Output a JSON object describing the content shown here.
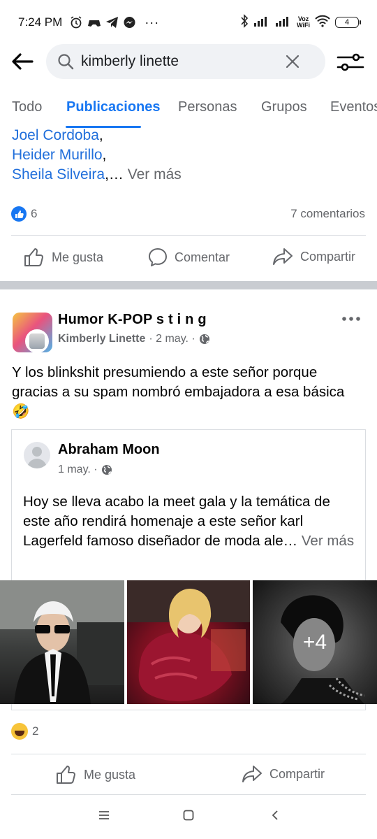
{
  "status_bar": {
    "time": "7:24 PM",
    "network_label": "Voz\nWiFi",
    "battery": "4"
  },
  "search": {
    "query": "kimberly linette"
  },
  "tabs": [
    {
      "label": "Todo",
      "active": false
    },
    {
      "label": "Publicaciones",
      "active": true
    },
    {
      "label": "Personas",
      "active": false
    },
    {
      "label": "Grupos",
      "active": false
    },
    {
      "label": "Eventos",
      "active": false
    }
  ],
  "previous_post": {
    "names": [
      "Joel Cordoba",
      "Heider Murillo",
      "Sheila Silveira"
    ],
    "comma": ",",
    "ellipsis": ",…",
    "see_more": "Ver más",
    "likes_count": "6",
    "comments_count": "7 comentarios",
    "actions": {
      "like": "Me gusta",
      "comment": "Comentar",
      "share": "Compartir"
    }
  },
  "post": {
    "page_name": "Humor K-POP s t i n g",
    "author": "Kimberly Linette",
    "date": "· 2 may. ·",
    "text": "Y los blinkshit presumiendo a este señor porque gracias a su spam nombró embajadora a esa básica 🤣",
    "shared": {
      "name": "Abraham Moon",
      "date": "1 may. ·",
      "text": "Hoy se lleva acabo la meet gala y la temática de este año rendirá homenaje a este señor karl Lagerfeld famoso diseñador de moda ale…",
      "see_more": "Ver más",
      "photos_more": "+4"
    },
    "reactions_count": "2",
    "actions": {
      "like": "Me gusta",
      "share": "Compartir"
    }
  },
  "colors": {
    "accent": "#1877f2",
    "link": "#216fdb",
    "secondary_text": "#65676b",
    "divider": "#dadde1",
    "section_gap": "#c9ccd1"
  }
}
